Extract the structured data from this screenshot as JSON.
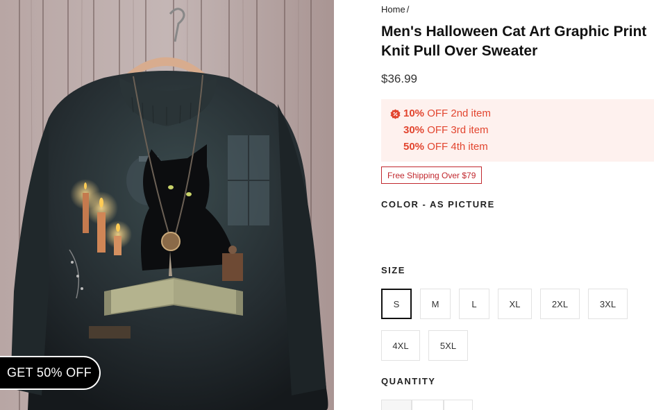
{
  "promo": {
    "label": "GET 50% OFF"
  },
  "breadcrumb": {
    "home": "Home",
    "separator": "/"
  },
  "product": {
    "title": "Men's Halloween Cat Art Graphic Print Knit Pull Over Sweater",
    "price": "$36.99"
  },
  "discounts": [
    {
      "percent": "10%",
      "text": "OFF 2nd item"
    },
    {
      "percent": "30%",
      "text": "OFF 3rd item"
    },
    {
      "percent": "50%",
      "text": "OFF 4th item"
    }
  ],
  "shipping_badge": "Free Shipping Over $79",
  "color": {
    "label": "COLOR - AS PICTURE"
  },
  "size": {
    "label": "SIZE",
    "selected": "S",
    "options": [
      "S",
      "M",
      "L",
      "XL",
      "2XL",
      "3XL",
      "4XL",
      "5XL"
    ]
  },
  "quantity": {
    "label": "QUANTITY"
  },
  "colors": {
    "accent": "#e2452f",
    "badge": "#c1272d",
    "discount_bg": "#fef1ee"
  },
  "icons": {
    "discount": "discount-badge-icon"
  }
}
